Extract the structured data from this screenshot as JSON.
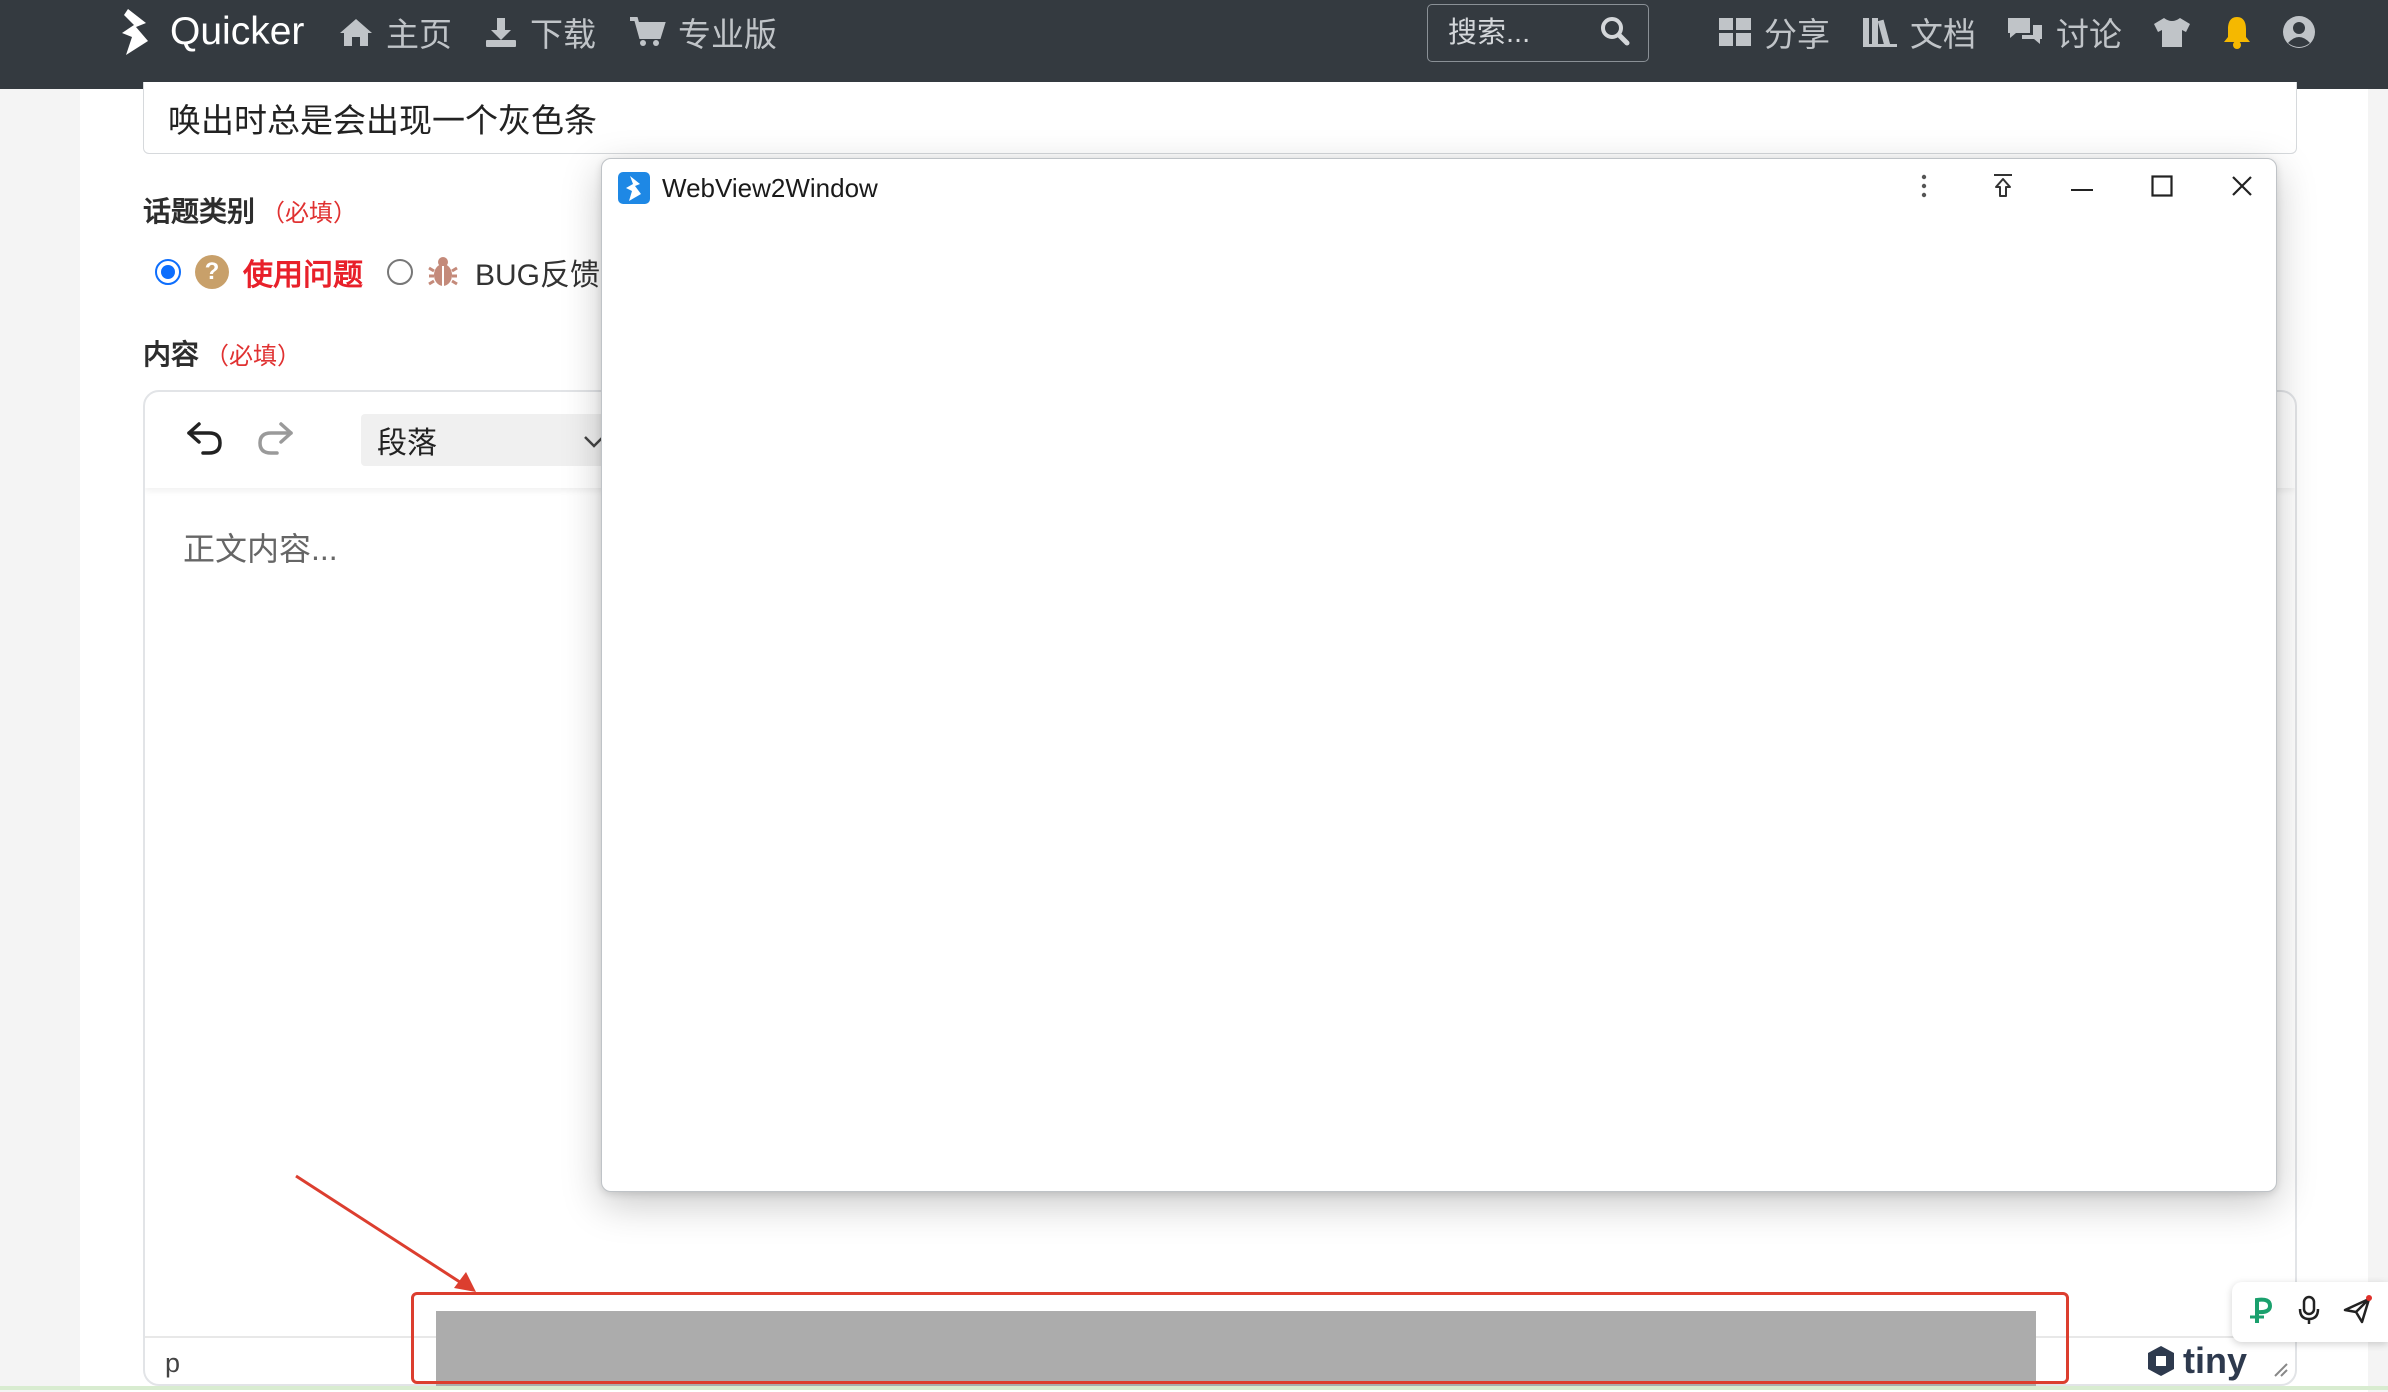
{
  "navbar": {
    "brand": "Quicker",
    "links": [
      {
        "label": "主页",
        "icon": "home-icon"
      },
      {
        "label": "下载",
        "icon": "download-icon"
      },
      {
        "label": "专业版",
        "icon": "cart-icon"
      }
    ],
    "search_placeholder": "搜索...",
    "right_links": [
      {
        "label": "分享",
        "icon": "grid-icon"
      },
      {
        "label": "文档",
        "icon": "books-icon"
      },
      {
        "label": "讨论",
        "icon": "comments-icon"
      }
    ],
    "icons": [
      "tshirt-icon",
      "bell-icon",
      "user-icon"
    ],
    "bell_color": "#f5b800"
  },
  "form": {
    "title_value": "唤出时总是会出现一个灰色条",
    "category_label": "话题类别",
    "required_mark": "（必填）",
    "options": [
      {
        "label": "使用问题",
        "selected": true
      },
      {
        "label": "BUG反馈",
        "selected": false
      }
    ],
    "content_label": "内容"
  },
  "editor": {
    "format_value": "段落",
    "placeholder": "正文内容...",
    "status_path": "p",
    "branding": "tiny"
  },
  "window": {
    "title": "WebView2Window"
  },
  "colors": {
    "navbar_bg": "#343a40",
    "required": "#e03131",
    "selected_option": "#e8202a",
    "annotation": "#dc3e2f",
    "gray_bar": "#acacac"
  }
}
